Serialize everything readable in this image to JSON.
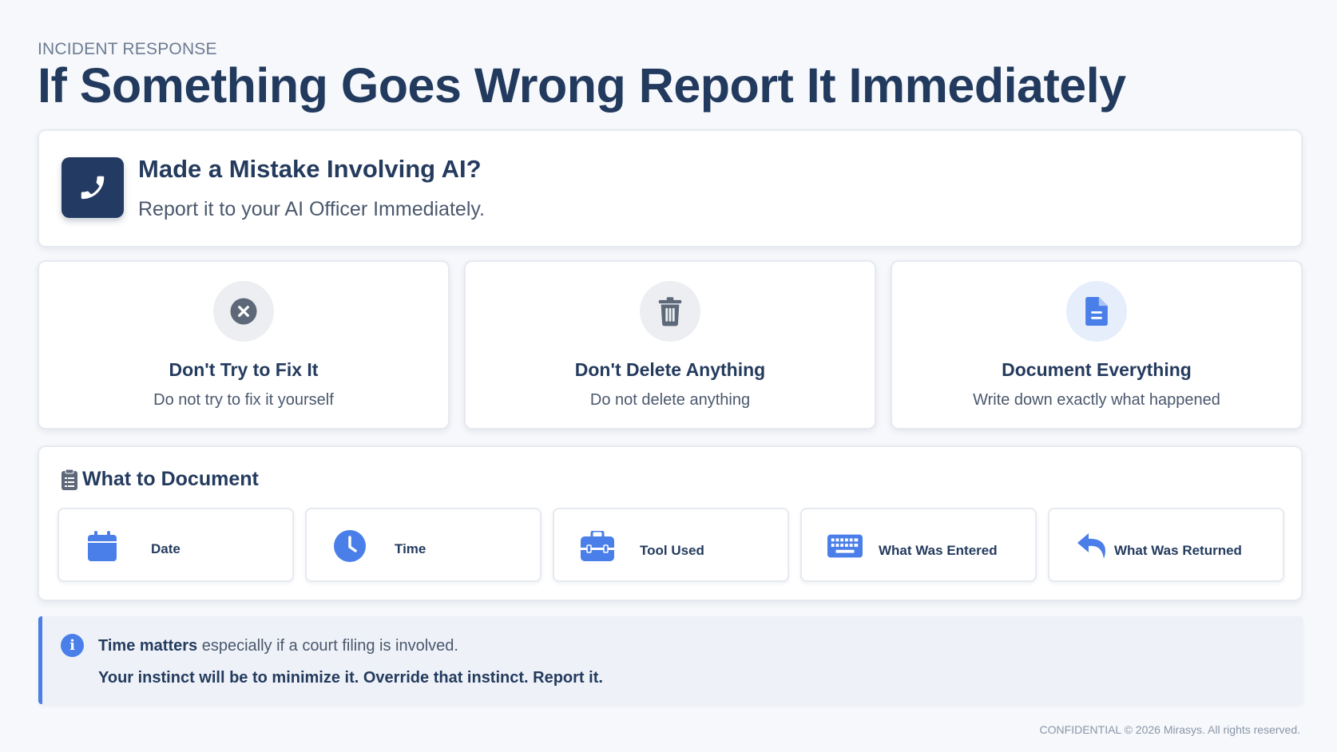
{
  "header": {
    "eyebrow": "INCIDENT RESPONSE",
    "title": "If Something Goes Wrong Report It Immediately"
  },
  "hero": {
    "icon": "phone-icon",
    "title": "Made a Mistake Involving AI?",
    "subtitle": "Report it to your AI Officer Immediately."
  },
  "rules": [
    {
      "icon": "x-circle-icon",
      "title": "Don't Try to Fix It",
      "subtitle": "Do not try to fix it yourself"
    },
    {
      "icon": "trash-icon",
      "title": "Don't Delete Anything",
      "subtitle": "Do not delete anything"
    },
    {
      "icon": "document-icon",
      "title": "Document Everything",
      "subtitle": "Write down exactly what happened"
    }
  ],
  "document_section": {
    "icon": "clipboard-icon",
    "title": "What to Document",
    "items": [
      {
        "icon": "calendar-icon",
        "label": "Date"
      },
      {
        "icon": "clock-icon",
        "label": "Time"
      },
      {
        "icon": "toolbox-icon",
        "label": "Tool Used"
      },
      {
        "icon": "keyboard-icon",
        "label": "What Was Entered"
      },
      {
        "icon": "reply-icon",
        "label": "What Was Returned"
      }
    ]
  },
  "note": {
    "icon": "info-icon",
    "line1_bold": "Time matters",
    "line1_rest": " especially if a court filing is involved.",
    "line2": "Your instinct will be to minimize it. Override that instinct. Report it."
  },
  "footer": "CONFIDENTIAL © 2026 Mirasys. All rights reserved.",
  "colors": {
    "navy": "#233b62",
    "accent_blue": "#4a7ee8",
    "gray_icon": "#5d6878"
  }
}
